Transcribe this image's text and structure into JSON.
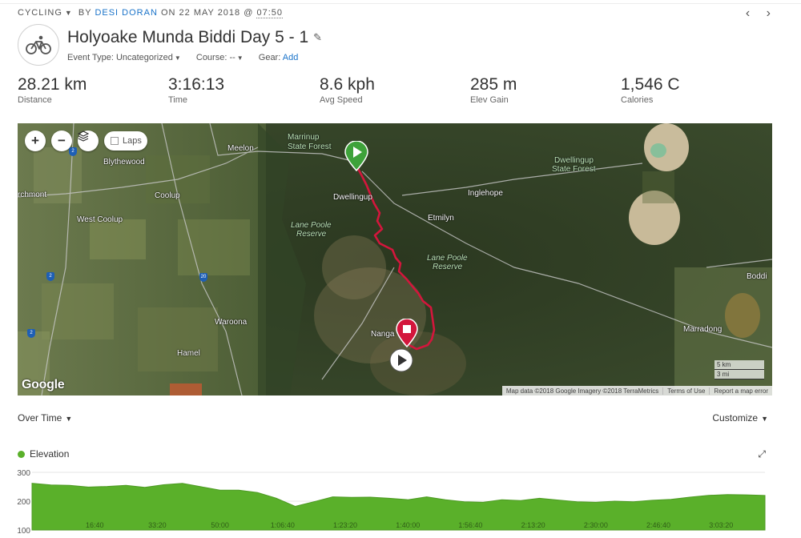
{
  "header": {
    "sport": "CYCLING",
    "sport_caret": "▼",
    "by": "BY",
    "author": "DESI DORAN",
    "on": "ON 22 MAY 2018 @",
    "time": "07:50",
    "prev": "‹",
    "next": "›"
  },
  "activity": {
    "title": "Holyoake Munda Biddi Day 5 - 1",
    "event_type": "Event Type: Uncategorized",
    "course": "Course: --",
    "gear_label": "Gear:",
    "gear_action": "Add"
  },
  "stats": [
    {
      "value": "28.21 km",
      "label": "Distance"
    },
    {
      "value": "3:16:13",
      "label": "Time"
    },
    {
      "value": "8.6 kph",
      "label": "Avg Speed"
    },
    {
      "value": "285 m",
      "label": "Elev Gain"
    },
    {
      "value": "1,546 C",
      "label": "Calories"
    }
  ],
  "map": {
    "zoom_in": "+",
    "zoom_out": "−",
    "laps_label": "Laps",
    "google": "Google",
    "footer": [
      "Map data ©2018 Google Imagery ©2018 TerraMetrics",
      "Terms of Use",
      "Report a map error"
    ],
    "scale_km": "5 km",
    "scale_mi": "3 mi",
    "places": {
      "marrinup": "Marrinup",
      "marrinup2": "State Forest",
      "meelon": "Meelon",
      "blythewood": "Blythewood",
      "orchmont": "rchmont",
      "coolup": "Coolup",
      "west_coolup": "West Coolup",
      "dwellingup": "Dwellingup",
      "inglehope": "Inglehope",
      "etmilyn": "Etmilyn",
      "lane_poole1": "Lane Poole",
      "lane_poole1b": "Reserve",
      "lane_poole2": "Lane Poole",
      "lane_poole2b": "Reserve",
      "dwellingup_sf": "Dwellingup",
      "dwellingup_sf2": "State Forest",
      "waroona": "Waroona",
      "hamel": "Hamel",
      "nanga": "Nanga",
      "marradong": "Marradong",
      "boddington": "Boddi"
    },
    "routes": [
      "2",
      "20",
      "2",
      "2"
    ]
  },
  "chart_controls": {
    "over_time": "Over Time",
    "customize": "Customize",
    "caret": "▼",
    "expand": "⤢"
  },
  "chart_data": {
    "type": "area",
    "series": [
      {
        "name": "Elevation",
        "color": "#5ab02a",
        "x_seconds": [
          0,
          300,
          600,
          900,
          1200,
          1500,
          1800,
          2100,
          2400,
          2700,
          3000,
          3300,
          3600,
          3900,
          4200,
          4500,
          4800,
          5100,
          5400,
          5700,
          6000,
          6300,
          6600,
          6900,
          7200,
          7500,
          7800,
          8100,
          8400,
          8700,
          9000,
          9300,
          9600,
          9900,
          10200,
          10500,
          10800,
          11100,
          11400,
          11700
        ],
        "values": [
          262,
          256,
          255,
          249,
          251,
          255,
          248,
          257,
          262,
          250,
          238,
          238,
          230,
          210,
          182,
          198,
          215,
          213,
          214,
          210,
          205,
          215,
          205,
          198,
          196,
          205,
          202,
          210,
          204,
          198,
          196,
          200,
          198,
          203,
          206,
          214,
          220,
          223,
          222,
          220
        ]
      }
    ],
    "ylim": [
      100,
      300
    ],
    "yticks": [
      "300",
      "200",
      "100"
    ],
    "xticks": [
      "16:40",
      "33:20",
      "50:00",
      "1:06:40",
      "1:23:20",
      "1:40:00",
      "1:56:40",
      "2:13:20",
      "2:30:00",
      "2:46:40",
      "3:03:20"
    ]
  }
}
